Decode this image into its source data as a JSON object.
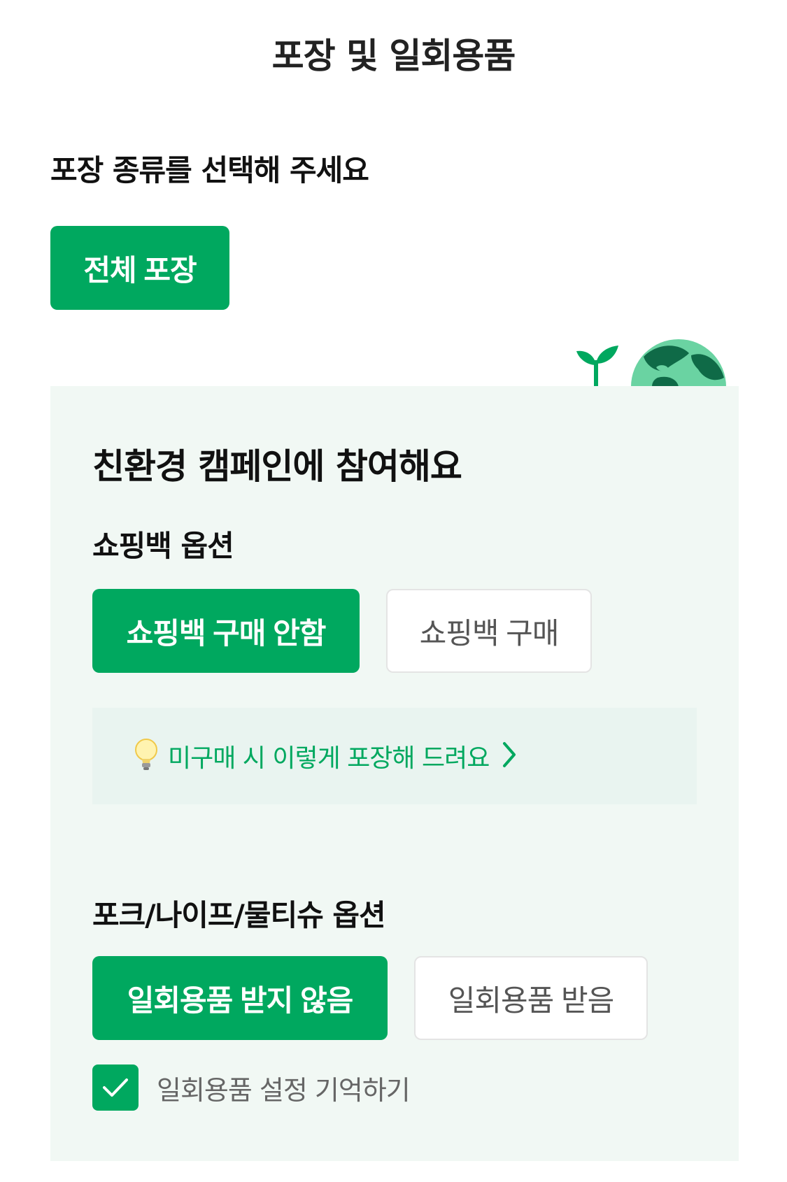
{
  "header": {
    "title": "포장 및 일회용품"
  },
  "packaging": {
    "heading": "포장 종류를 선택해 주세요",
    "selected_option": "전체 포장"
  },
  "eco_campaign": {
    "title": "친환경 캠페인에 참여해요",
    "illustration_icons": [
      "sprout-icon",
      "earth-globe-icon"
    ],
    "shopping_bag": {
      "heading": "쇼핑백 옵션",
      "options": [
        {
          "label": "쇼핑백 구매 안함",
          "selected": true
        },
        {
          "label": "쇼핑백 구매",
          "selected": false
        }
      ]
    },
    "hint": {
      "icon": "lightbulb-icon",
      "text": "미구매 시 이렇게 포장해 드려요",
      "chevron_icon": "chevron-right-icon"
    },
    "utensils": {
      "heading": "포크/나이프/물티슈 옵션",
      "options": [
        {
          "label": "일회용품 받지 않음",
          "selected": true
        },
        {
          "label": "일회용품 받음",
          "selected": false
        }
      ],
      "remember": {
        "label": "일회용품 설정 기억하기",
        "checked": true
      }
    }
  },
  "colors": {
    "accent_green": "#00a85f",
    "panel_background": "#f1f8f4",
    "hint_background": "#e9f4f0"
  }
}
